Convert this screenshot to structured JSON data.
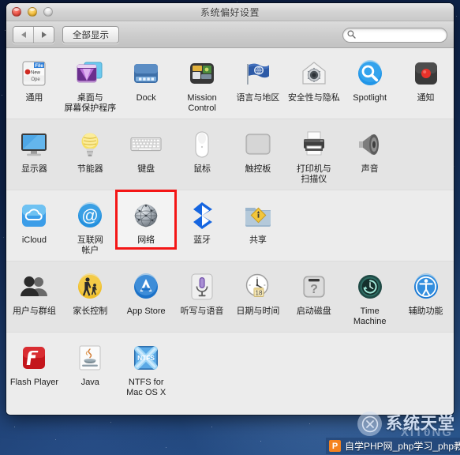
{
  "window": {
    "title": "系统偏好设置",
    "controls": {
      "close": "close-button",
      "minimize": "minimize-button",
      "zoom": "zoom-button"
    }
  },
  "toolbar": {
    "back_label": "◀",
    "forward_label": "▶",
    "show_all_label": "全部显示",
    "search": {
      "value": "",
      "placeholder": ""
    }
  },
  "rows": [
    {
      "items": [
        {
          "label": "通用",
          "icon": "general-icon"
        },
        {
          "label": "桌面与\n屏幕保护程序",
          "line1": "桌面与",
          "line2": "屏幕保护程序",
          "icon": "desktop-screensaver-icon"
        },
        {
          "label": "Dock",
          "icon": "dock-icon"
        },
        {
          "label": "Mission\nControl",
          "line1": "Mission",
          "line2": "Control",
          "icon": "mission-control-icon"
        },
        {
          "label": "语言与地区",
          "icon": "language-region-icon"
        },
        {
          "label": "安全性与隐私",
          "icon": "security-privacy-icon"
        },
        {
          "label": "Spotlight",
          "icon": "spotlight-icon"
        },
        {
          "label": "通知",
          "icon": "notifications-icon"
        }
      ]
    },
    {
      "items": [
        {
          "label": "显示器",
          "icon": "displays-icon"
        },
        {
          "label": "节能器",
          "icon": "energy-saver-icon"
        },
        {
          "label": "键盘",
          "icon": "keyboard-icon"
        },
        {
          "label": "鼠标",
          "icon": "mouse-icon"
        },
        {
          "label": "触控板",
          "icon": "trackpad-icon"
        },
        {
          "label": "打印机与\n扫描仪",
          "line1": "打印机与",
          "line2": "扫描仪",
          "icon": "printers-scanners-icon"
        },
        {
          "label": "声音",
          "icon": "sound-icon"
        }
      ]
    },
    {
      "items": [
        {
          "label": "iCloud",
          "icon": "icloud-icon"
        },
        {
          "label": "互联网\n帐户",
          "line1": "互联网",
          "line2": "帐户",
          "icon": "internet-accounts-icon"
        },
        {
          "label": "网络",
          "icon": "network-icon",
          "highlighted": true
        },
        {
          "label": "蓝牙",
          "icon": "bluetooth-icon"
        },
        {
          "label": "共享",
          "icon": "sharing-icon"
        }
      ]
    },
    {
      "items": [
        {
          "label": "用户与群组",
          "icon": "users-groups-icon"
        },
        {
          "label": "家长控制",
          "icon": "parental-controls-icon"
        },
        {
          "label": "App Store",
          "icon": "app-store-icon"
        },
        {
          "label": "听写与语音",
          "icon": "dictation-speech-icon"
        },
        {
          "label": "日期与时间",
          "icon": "date-time-icon"
        },
        {
          "label": "启动磁盘",
          "icon": "startup-disk-icon"
        },
        {
          "label": "Time Machine",
          "icon": "time-machine-icon"
        },
        {
          "label": "辅助功能",
          "icon": "accessibility-icon"
        }
      ]
    },
    {
      "items": [
        {
          "label": "Flash Player",
          "icon": "flash-player-icon"
        },
        {
          "label": "Java",
          "icon": "java-icon"
        },
        {
          "label": "NTFS for\nMac OS X",
          "line1": "NTFS for",
          "line2": "Mac OS X",
          "icon": "ntfs-icon"
        }
      ]
    }
  ],
  "watermarks": {
    "site_name": "系统天堂",
    "site_sub": "XIT0NG",
    "taskbar_logo": "P",
    "taskbar_text": "自学PHP网_php学习_php教程"
  },
  "colors": {
    "highlight": "#f41616",
    "window_bg": "#ececec",
    "row_alt_bg": "#e4e4e4",
    "desktop": "#112a55"
  }
}
